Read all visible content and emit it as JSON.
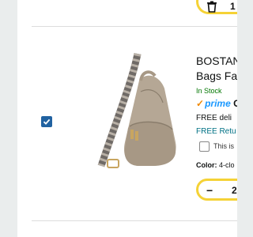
{
  "previous_item": {
    "quantity": "1",
    "icons": [
      "trash-icon"
    ]
  },
  "item": {
    "selected": true,
    "image": "crossbody-sling-bag-beige",
    "title_line1": "BOSTAN",
    "title_line2": "Bags Fa",
    "stock": "In Stock",
    "prime_label": "prime",
    "prime_suffix": "C",
    "free_delivery": "FREE deli",
    "free_returns": "FREE Retu",
    "gift_label": "This is",
    "color_label": "Color:",
    "color_value": "4-clo",
    "quantity": "2",
    "minus_symbol": "−"
  },
  "colors": {
    "accent_yellow": "#f5d236",
    "checkbox_blue": "#2162a1",
    "stock_green": "#007600",
    "prime_blue": "#1a98ff",
    "link_teal": "#007185"
  }
}
